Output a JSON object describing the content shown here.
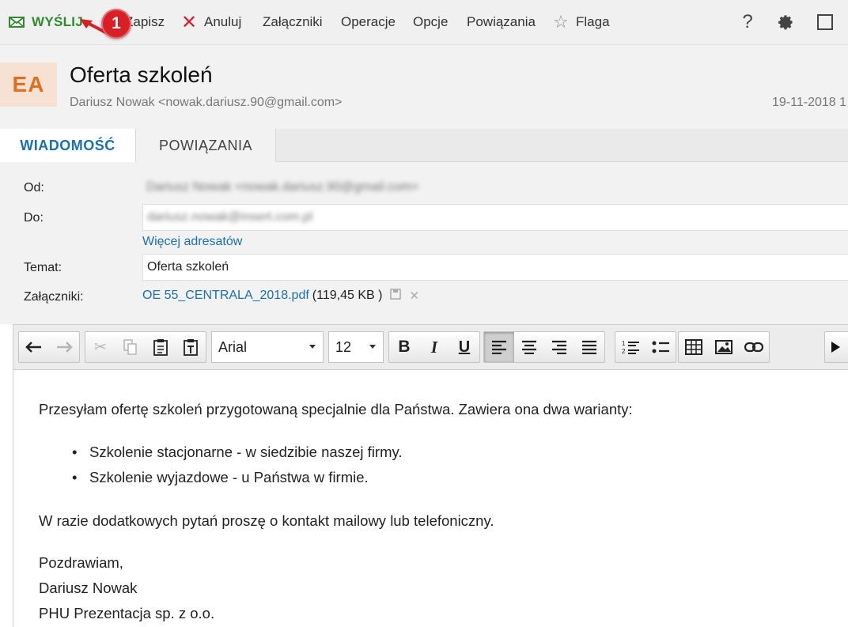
{
  "toolbar": {
    "send_label": "WYŚLIJ",
    "save_label": "Zapisz",
    "cancel_label": "Anuluj",
    "attachments_label": "Załączniki",
    "operations_label": "Operacje",
    "options_label": "Opcje",
    "relations_label": "Powiązania",
    "flag_label": "Flaga",
    "help_label": "?"
  },
  "annotation": {
    "number": "1",
    "color": "#d81f26"
  },
  "header": {
    "avatar": "EA",
    "subject": "Oferta szkoleń",
    "sender": "Dariusz Nowak <nowak.dariusz.90@gmail.com>",
    "date": "19-11-2018 1"
  },
  "tabs": {
    "message": "WIADOMOŚĆ",
    "relations": "POWIĄZANIA"
  },
  "form": {
    "from_label": "Od:",
    "from_value": "Dariusz Nowak <nowak.dariusz.90@gmail.com>",
    "to_label": "Do:",
    "to_value": "dariusz.nowak@insert.com.pl",
    "more_recipients": "Więcej adresatów",
    "subject_label": "Temat:",
    "subject_value": "Oferta szkoleń",
    "attachments_label": "Załączniki:",
    "attachment_name": "OE 55_CENTRALA_2018.pdf",
    "attachment_size": "(119,45 KB )"
  },
  "editor": {
    "font_name": "Arial",
    "font_size": "12",
    "intro": "Przesyłam ofertę szkoleń przygotowaną specjalnie dla Państwa. Zawiera ona dwa warianty:",
    "bullets": [
      "Szkolenie stacjonarne - w siedzibie naszej firmy.",
      "Szkolenie wyjazdowe - u Państwa w firmie."
    ],
    "contact": "W razie dodatkowych pytań proszę o kontakt mailowy lub telefoniczny.",
    "greeting": "Pozdrawiam,",
    "signature_name": "Dariusz Nowak",
    "signature_company": "PHU Prezentacja sp. z o.o."
  },
  "colors": {
    "accent": "#1a6fb5",
    "send": "#2e8b2e",
    "cancel": "#d6222a",
    "avatar_text": "#e07020"
  }
}
